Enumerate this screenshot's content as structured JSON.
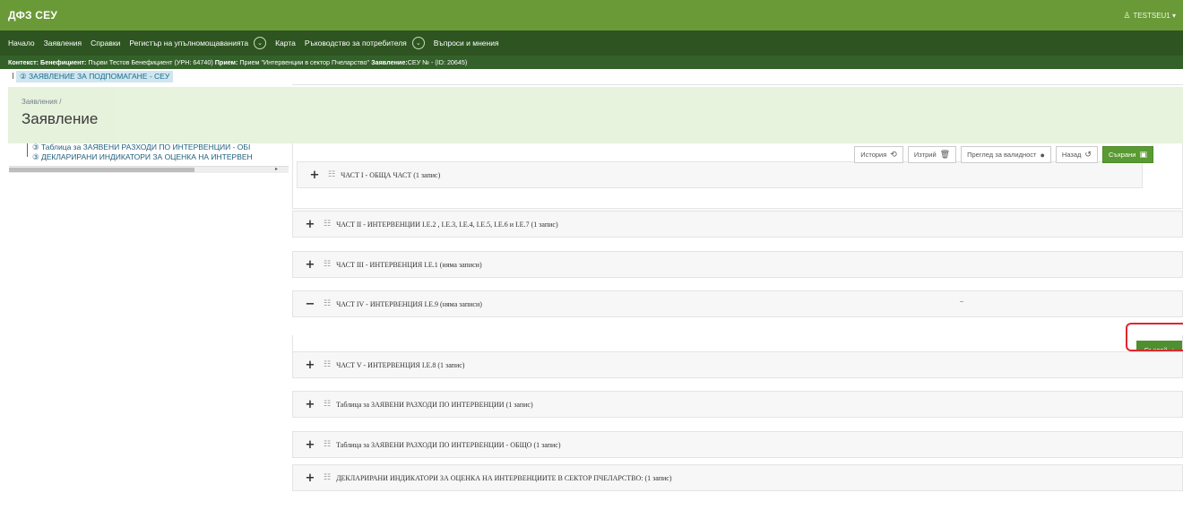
{
  "header": {
    "app_title": "ДФЗ СЕУ",
    "user": "TESTSEU1 ▾"
  },
  "nav": {
    "items": [
      "Начало",
      "Заявления",
      "Справки",
      "Регистър на упълномощаванията",
      "Карта",
      "Ръководство за потребителя",
      "Въпроси и мнения"
    ]
  },
  "context": {
    "label_beneficiary": "Контекст: Бенефициент:",
    "beneficiary_value": " Първи Тестов Бенефициент (УРН: 64740) ",
    "label_intake": "Прием:",
    "intake_value": " Прием \"Интервенции в сектор Пчеларство\" ",
    "label_application": "Заявление:",
    "application_value": "СЕУ № - (ID: 20645)"
  },
  "tree": {
    "root": "② ЗАЯВЛЕНИЕ ЗА ПОДПОМАГАНЕ - СЕУ",
    "child1": "③ Таблица за ЗАЯВЕНИ РАЗХОДИ ПО ИНТЕРВЕНЦИИ - ОБІ",
    "child2": "③ ДЕКЛАРИРАНИ ИНДИКАТОРИ ЗА ОЦЕНКА НА ИНТЕРВЕН"
  },
  "page": {
    "breadcrumb": "Заявления /",
    "title": "Заявление"
  },
  "toolbar": {
    "history": "История",
    "delete": "Изтрий",
    "validity": "Преглед за валидност",
    "back": "Назад",
    "save": "Съхрани"
  },
  "sections": {
    "s1": "ЧАСТ I - ОБЩА ЧАСТ (1 запис)",
    "s2": "ЧАСТ II - ИНТЕРВЕНЦИИ I.Е.2 , I.Е.3, I.Е.4, I.Е.5, I.Е.6 и I.Е.7 (1 запис)",
    "s3": "ЧАСТ III - ИНТЕРВЕНЦИЯ I.Е.1 (няма записи)",
    "s4": "ЧАСТ IV - ИНТЕРВЕНЦИЯ I.Е.9 (няма записи)",
    "s5": "ЧАСТ V - ИНТЕРВЕНЦИЯ I.Е.8 (1 запис)",
    "s6": "Таблица за ЗАЯВЕНИ РАЗХОДИ ПО ИНТЕРВЕНЦИИ (1 запис)",
    "s7": "Таблица за ЗАЯВЕНИ РАЗХОДИ ПО ИНТЕРВЕНЦИИ - ОБЩО (1 запис)",
    "s8": "ДЕКЛАРИРАНИ ИНДИКАТОРИ ЗА ОЦЕНКА НА ИНТЕРВЕНЦИИТЕ В СЕКТОР ПЧЕЛАРСТВО: (1 запис)"
  },
  "create_button": "Създай",
  "colors": {
    "topbar": "#6a9a37",
    "navbar": "#2e5421",
    "accent": "#5a9a32",
    "highlight": "#e0262f"
  }
}
